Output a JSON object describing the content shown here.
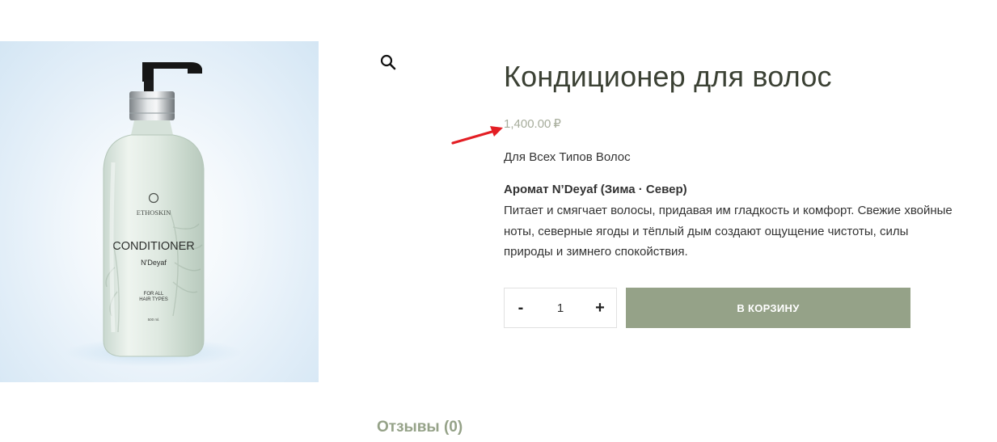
{
  "product": {
    "title": "Кондиционер для волос",
    "price": "1,400.00",
    "currency_symbol": "₽",
    "subtitle": "Для Всех Типов Волос",
    "aroma_heading": "Аромат N’Deyaf (Зима · Север)",
    "description": "Питает и смягчает волосы, придавая им гладкость и комфорт. Свежие хвойные ноты, северные ягоды и тёплый дым создают ощущение чистоты, силы природы и зимнего спокойствия."
  },
  "image_label": {
    "brand": "ETHOSKIN",
    "product_name": "CONDITIONER",
    "scent": "N'Deyaf",
    "line1": "FOR ALL",
    "line2": "HAIR TYPES",
    "volume": "500 ml."
  },
  "cart": {
    "minus_label": "-",
    "plus_label": "+",
    "quantity": "1",
    "add_to_cart_label": "В КОРЗИНУ"
  },
  "tabs": {
    "reviews_label": "Отзывы (0)"
  },
  "icons": {
    "zoom": "magnifier-icon",
    "arrow": "red-arrow-annotation"
  },
  "colors": {
    "accent": "#95a288",
    "title": "#3b4134",
    "price": "#a7ad9c",
    "annotation": "#e31e24"
  }
}
